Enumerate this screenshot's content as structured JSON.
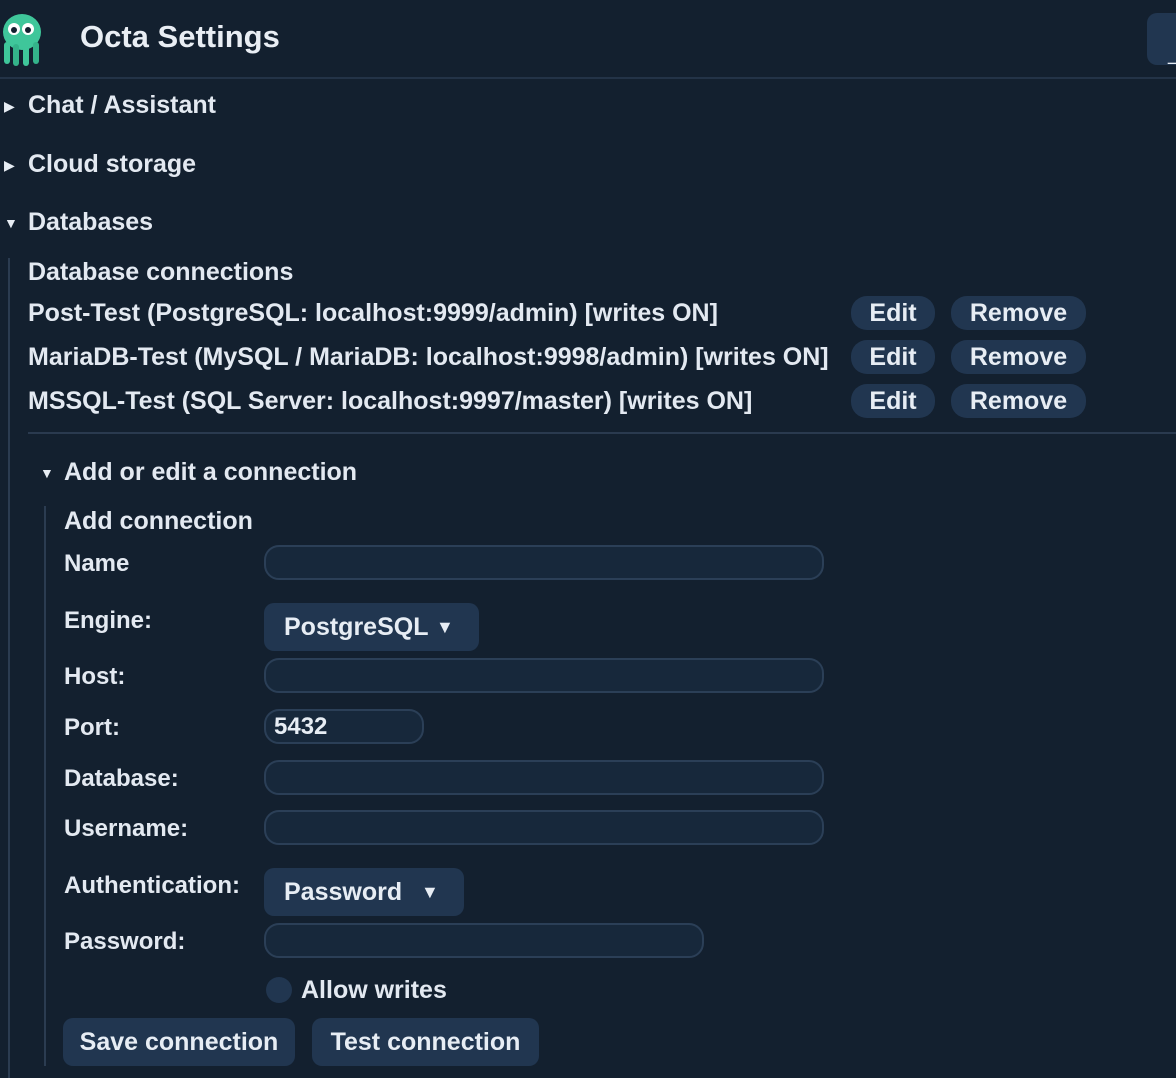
{
  "app": {
    "title": "Octa Settings",
    "corner_button_label": "_"
  },
  "sections": {
    "chat": {
      "label": "Chat / Assistant",
      "expanded": false
    },
    "cloud": {
      "label": "Cloud storage",
      "expanded": false
    },
    "databases": {
      "label": "Databases",
      "expanded": true
    }
  },
  "databases": {
    "heading": "Database connections",
    "connections": [
      {
        "text": "Post-Test  (PostgreSQL: localhost:9999/admin)  [writes ON]",
        "edit_label": "Edit",
        "remove_label": "Remove"
      },
      {
        "text": "MariaDB-Test  (MySQL / MariaDB: localhost:9998/admin)  [writes ON]",
        "edit_label": "Edit",
        "remove_label": "Remove"
      },
      {
        "text": "MSSQL-Test  (SQL Server: localhost:9997/master)  [writes ON]",
        "edit_label": "Edit",
        "remove_label": "Remove"
      }
    ],
    "editor": {
      "section_label": "Add or edit a connection",
      "heading": "Add connection",
      "fields": {
        "name": {
          "label": "Name",
          "value": ""
        },
        "engine": {
          "label": "Engine:",
          "value": "PostgreSQL"
        },
        "host": {
          "label": "Host:",
          "value": ""
        },
        "port": {
          "label": "Port:",
          "value": "5432"
        },
        "database": {
          "label": "Database:",
          "value": ""
        },
        "username": {
          "label": "Username:",
          "value": ""
        },
        "authentication": {
          "label": "Authentication:",
          "value": "Password"
        },
        "password": {
          "label": "Password:",
          "value": ""
        }
      },
      "allow_writes": {
        "label": "Allow writes",
        "checked": false
      },
      "save_label": "Save connection",
      "test_label": "Test connection"
    }
  },
  "colors": {
    "background": "#13202f",
    "button": "#213650",
    "input_bg": "#17283b",
    "text": "#e7edf4"
  }
}
